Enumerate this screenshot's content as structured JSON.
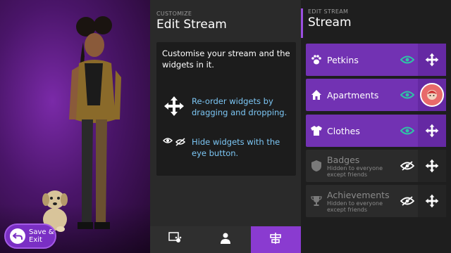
{
  "scene": {
    "save_exit_label": "Save &\nExit"
  },
  "center": {
    "caption": "CUSTOMIZE",
    "title": "Edit Stream",
    "intro": "Customise your stream and the widgets in it.",
    "tips": [
      {
        "icon": "move-arrows-icon",
        "text": "Re-order widgets by dragging and dropping."
      },
      {
        "icon": "eye-icon",
        "text": "Hide widgets with the eye button."
      }
    ],
    "tabs": [
      {
        "icon": "pet-photo-icon",
        "active": false
      },
      {
        "icon": "person-icon",
        "active": false
      },
      {
        "icon": "sliders-icon",
        "active": true
      }
    ]
  },
  "right": {
    "caption": "EDIT STREAM",
    "title": "Stream",
    "widgets": [
      {
        "name": "Petkins",
        "icon": "paw-icon",
        "visible": true,
        "subtitle": ""
      },
      {
        "name": "Apartments",
        "icon": "house-icon",
        "visible": true,
        "subtitle": ""
      },
      {
        "name": "Clothes",
        "icon": "shirt-icon",
        "visible": true,
        "subtitle": ""
      },
      {
        "name": "Badges",
        "icon": "shield-icon",
        "visible": false,
        "subtitle": "Hidden to everyone\nexcept friends"
      },
      {
        "name": "Achievements",
        "icon": "trophy-icon",
        "visible": false,
        "subtitle": "Hidden to everyone\nexcept friends"
      }
    ]
  },
  "colors": {
    "accent": "#8a3bd0",
    "row_on": "#7232b3",
    "eye_on": "#2ec4a6",
    "tip_text": "#7cc6f4"
  }
}
